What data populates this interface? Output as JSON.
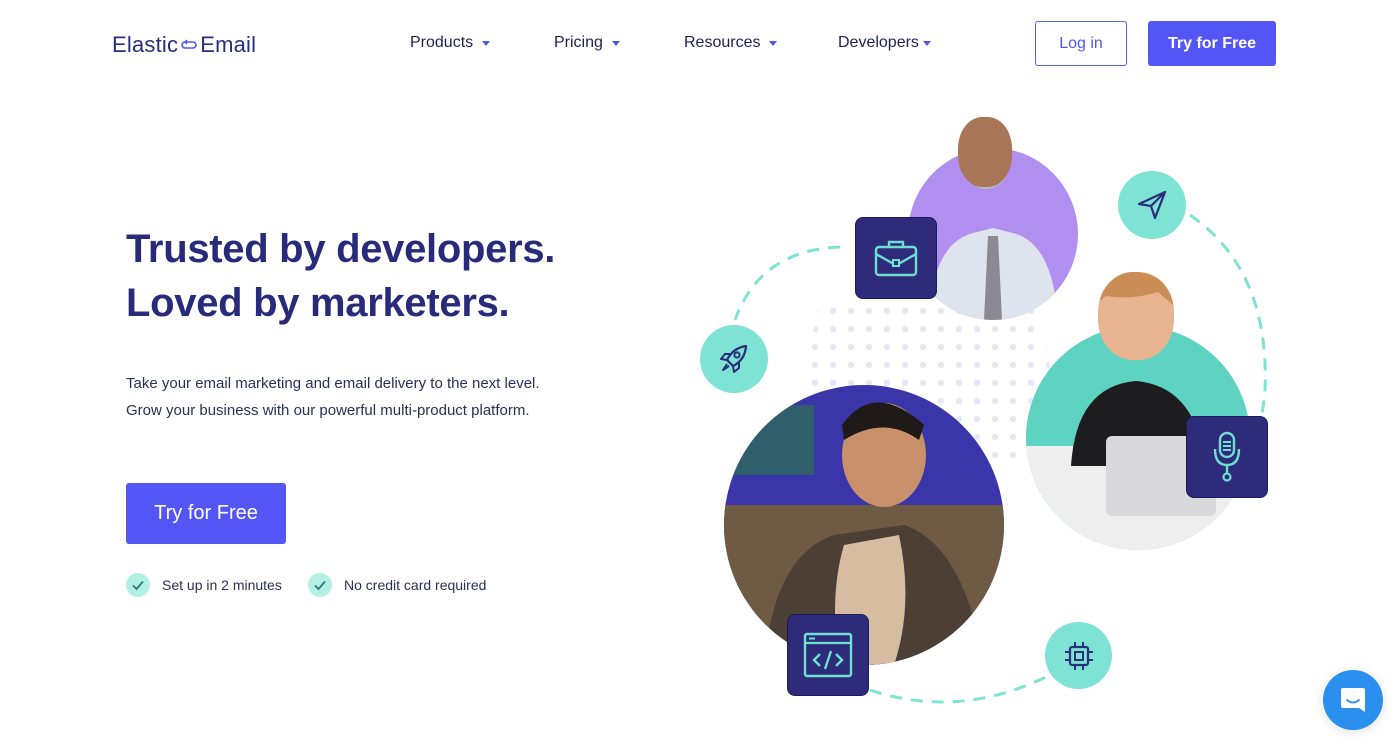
{
  "brand": {
    "name_left": "Elastic",
    "name_right": "Email",
    "primary_color": "#5356f5",
    "heading_color": "#272b7a",
    "accent_teal": "#7ee3d4",
    "tile_color": "#2d2b7a"
  },
  "nav": {
    "items": [
      {
        "label": "Products",
        "icon": "caret-down-icon"
      },
      {
        "label": "Pricing",
        "icon": "caret-down-icon"
      },
      {
        "label": "Resources",
        "icon": "caret-down-icon"
      },
      {
        "label": "Developers",
        "icon": "caret-down-icon"
      }
    ],
    "login_label": "Log in",
    "try_label": "Try for Free"
  },
  "hero": {
    "title_line1": "Trusted by developers.",
    "title_line2": "Loved by marketers.",
    "subtitle_line1": "Take your email marketing and email delivery to the next level.",
    "subtitle_line2": "Grow your business with our powerful multi-product platform.",
    "cta_label": "Try for Free",
    "checks": [
      {
        "label": "Set up in 2 minutes",
        "icon": "check-icon"
      },
      {
        "label": "No credit card required",
        "icon": "check-icon"
      }
    ]
  },
  "illustration": {
    "people": [
      {
        "name": "businessman-photo"
      },
      {
        "name": "woman-with-laptop-photo"
      },
      {
        "name": "developer-photo"
      }
    ],
    "icons": [
      "briefcase-icon",
      "paper-plane-icon",
      "rocket-icon",
      "microphone-icon",
      "code-window-icon",
      "chip-icon"
    ]
  },
  "chat": {
    "icon": "chat-icon"
  }
}
